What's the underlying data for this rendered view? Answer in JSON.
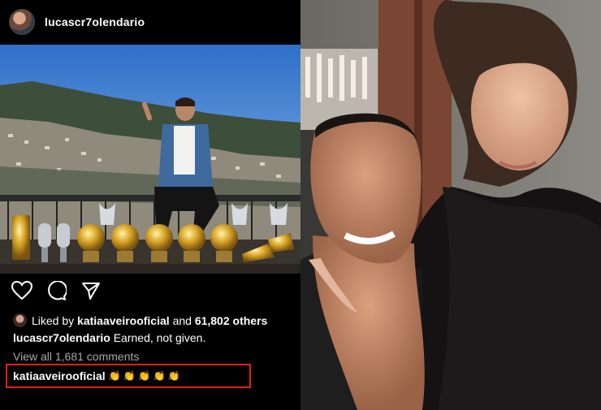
{
  "post": {
    "username": "lucascr7olendario",
    "likes": {
      "prefix": "Liked by",
      "liker": "katiaaveirooficial",
      "connector": "and",
      "others": "61,802 others"
    },
    "caption": {
      "user": "lucascr7olendario",
      "text": "Earned, not given."
    },
    "view_comments": "View all 1,681 comments",
    "highlighted_comment": {
      "user": "katiaaveirooficial",
      "emoji": "👏 👏 👏 👏 👏"
    }
  },
  "icons": [
    "heart-icon",
    "comment-icon",
    "share-icon"
  ],
  "colors": {
    "highlight_border": "#e0201f",
    "muted_text": "#a8a8a8"
  }
}
